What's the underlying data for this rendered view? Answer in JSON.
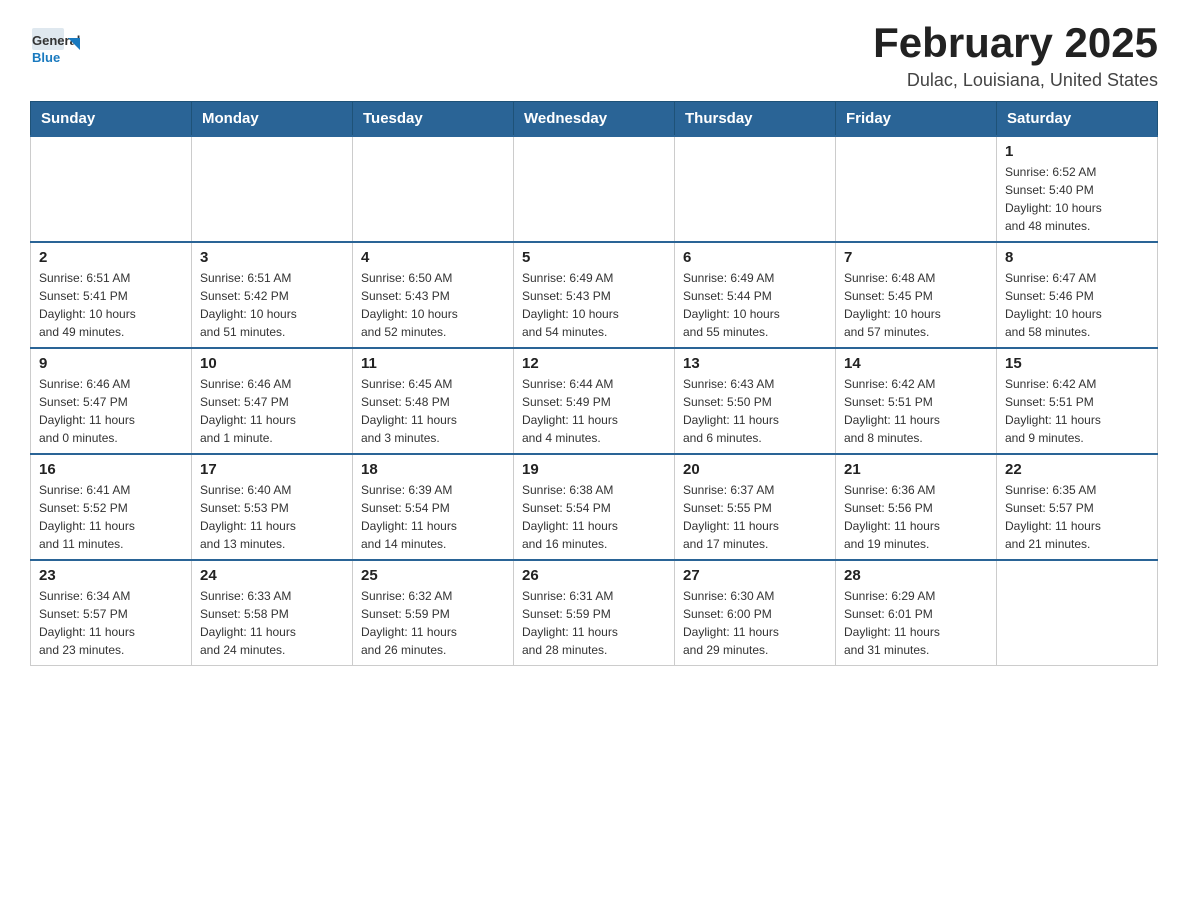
{
  "header": {
    "logo_general": "General",
    "logo_blue": "Blue",
    "month_title": "February 2025",
    "location": "Dulac, Louisiana, United States"
  },
  "days_of_week": [
    "Sunday",
    "Monday",
    "Tuesday",
    "Wednesday",
    "Thursday",
    "Friday",
    "Saturday"
  ],
  "weeks": [
    [
      {
        "day": "",
        "info": ""
      },
      {
        "day": "",
        "info": ""
      },
      {
        "day": "",
        "info": ""
      },
      {
        "day": "",
        "info": ""
      },
      {
        "day": "",
        "info": ""
      },
      {
        "day": "",
        "info": ""
      },
      {
        "day": "1",
        "info": "Sunrise: 6:52 AM\nSunset: 5:40 PM\nDaylight: 10 hours\nand 48 minutes."
      }
    ],
    [
      {
        "day": "2",
        "info": "Sunrise: 6:51 AM\nSunset: 5:41 PM\nDaylight: 10 hours\nand 49 minutes."
      },
      {
        "day": "3",
        "info": "Sunrise: 6:51 AM\nSunset: 5:42 PM\nDaylight: 10 hours\nand 51 minutes."
      },
      {
        "day": "4",
        "info": "Sunrise: 6:50 AM\nSunset: 5:43 PM\nDaylight: 10 hours\nand 52 minutes."
      },
      {
        "day": "5",
        "info": "Sunrise: 6:49 AM\nSunset: 5:43 PM\nDaylight: 10 hours\nand 54 minutes."
      },
      {
        "day": "6",
        "info": "Sunrise: 6:49 AM\nSunset: 5:44 PM\nDaylight: 10 hours\nand 55 minutes."
      },
      {
        "day": "7",
        "info": "Sunrise: 6:48 AM\nSunset: 5:45 PM\nDaylight: 10 hours\nand 57 minutes."
      },
      {
        "day": "8",
        "info": "Sunrise: 6:47 AM\nSunset: 5:46 PM\nDaylight: 10 hours\nand 58 minutes."
      }
    ],
    [
      {
        "day": "9",
        "info": "Sunrise: 6:46 AM\nSunset: 5:47 PM\nDaylight: 11 hours\nand 0 minutes."
      },
      {
        "day": "10",
        "info": "Sunrise: 6:46 AM\nSunset: 5:47 PM\nDaylight: 11 hours\nand 1 minute."
      },
      {
        "day": "11",
        "info": "Sunrise: 6:45 AM\nSunset: 5:48 PM\nDaylight: 11 hours\nand 3 minutes."
      },
      {
        "day": "12",
        "info": "Sunrise: 6:44 AM\nSunset: 5:49 PM\nDaylight: 11 hours\nand 4 minutes."
      },
      {
        "day": "13",
        "info": "Sunrise: 6:43 AM\nSunset: 5:50 PM\nDaylight: 11 hours\nand 6 minutes."
      },
      {
        "day": "14",
        "info": "Sunrise: 6:42 AM\nSunset: 5:51 PM\nDaylight: 11 hours\nand 8 minutes."
      },
      {
        "day": "15",
        "info": "Sunrise: 6:42 AM\nSunset: 5:51 PM\nDaylight: 11 hours\nand 9 minutes."
      }
    ],
    [
      {
        "day": "16",
        "info": "Sunrise: 6:41 AM\nSunset: 5:52 PM\nDaylight: 11 hours\nand 11 minutes."
      },
      {
        "day": "17",
        "info": "Sunrise: 6:40 AM\nSunset: 5:53 PM\nDaylight: 11 hours\nand 13 minutes."
      },
      {
        "day": "18",
        "info": "Sunrise: 6:39 AM\nSunset: 5:54 PM\nDaylight: 11 hours\nand 14 minutes."
      },
      {
        "day": "19",
        "info": "Sunrise: 6:38 AM\nSunset: 5:54 PM\nDaylight: 11 hours\nand 16 minutes."
      },
      {
        "day": "20",
        "info": "Sunrise: 6:37 AM\nSunset: 5:55 PM\nDaylight: 11 hours\nand 17 minutes."
      },
      {
        "day": "21",
        "info": "Sunrise: 6:36 AM\nSunset: 5:56 PM\nDaylight: 11 hours\nand 19 minutes."
      },
      {
        "day": "22",
        "info": "Sunrise: 6:35 AM\nSunset: 5:57 PM\nDaylight: 11 hours\nand 21 minutes."
      }
    ],
    [
      {
        "day": "23",
        "info": "Sunrise: 6:34 AM\nSunset: 5:57 PM\nDaylight: 11 hours\nand 23 minutes."
      },
      {
        "day": "24",
        "info": "Sunrise: 6:33 AM\nSunset: 5:58 PM\nDaylight: 11 hours\nand 24 minutes."
      },
      {
        "day": "25",
        "info": "Sunrise: 6:32 AM\nSunset: 5:59 PM\nDaylight: 11 hours\nand 26 minutes."
      },
      {
        "day": "26",
        "info": "Sunrise: 6:31 AM\nSunset: 5:59 PM\nDaylight: 11 hours\nand 28 minutes."
      },
      {
        "day": "27",
        "info": "Sunrise: 6:30 AM\nSunset: 6:00 PM\nDaylight: 11 hours\nand 29 minutes."
      },
      {
        "day": "28",
        "info": "Sunrise: 6:29 AM\nSunset: 6:01 PM\nDaylight: 11 hours\nand 31 minutes."
      },
      {
        "day": "",
        "info": ""
      }
    ]
  ]
}
